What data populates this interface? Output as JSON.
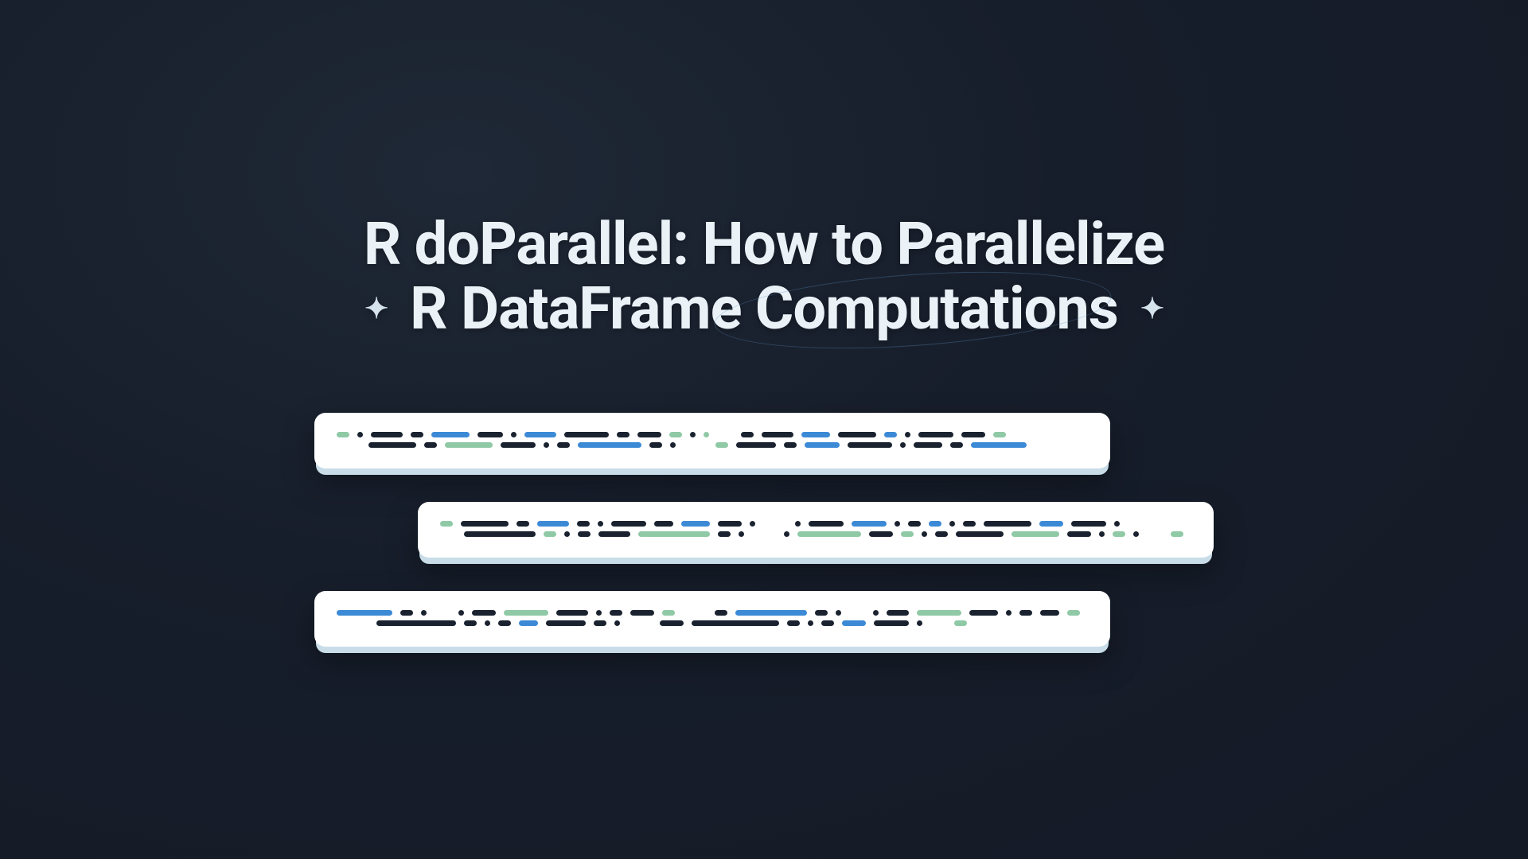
{
  "title": {
    "line1": "R doParallel: How to Parallelize",
    "line2": "R DataFrame Computations"
  },
  "colors": {
    "background": "#171e2b",
    "title_text": "#eaf2f8",
    "card_bg": "#ffffff",
    "card_shadow": "#c8dde8",
    "code_dark": "#1a2230",
    "code_blue": "#3c8ad6",
    "code_green": "#8fc9a5"
  },
  "cards": [
    {
      "offset": false,
      "lines": 2
    },
    {
      "offset": true,
      "lines": 2
    },
    {
      "offset": false,
      "lines": 2
    }
  ]
}
